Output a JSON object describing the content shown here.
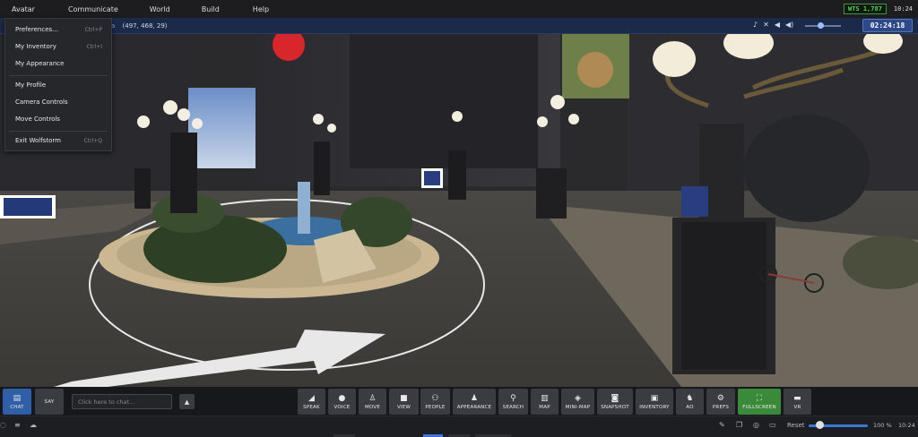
{
  "menu": {
    "items": [
      "Avatar",
      "Communicate",
      "World",
      "Build",
      "Help"
    ],
    "balance": "WTS 1,787",
    "time": "10:24"
  },
  "location": {
    "region_suffix": "a",
    "coords": "(497, 468, 29)"
  },
  "timer": "02:24:18",
  "dropdown": {
    "items": [
      {
        "label": "Preferences...",
        "shortcut": "Ctrl+P"
      },
      {
        "label": "My Inventory",
        "shortcut": "Ctrl+I"
      },
      {
        "label": "My Appearance",
        "shortcut": ""
      },
      {
        "label": "My Profile",
        "shortcut": ""
      },
      {
        "label": "Camera Controls",
        "shortcut": ""
      },
      {
        "label": "Move Controls",
        "shortcut": ""
      },
      {
        "label": "Exit Wolfstorm",
        "shortcut": "Ctrl+Q"
      }
    ]
  },
  "toolbar": {
    "chat_label": "CHAT",
    "say_label": "SAY",
    "chat_placeholder": "Click here to chat...",
    "buttons": [
      {
        "label": "SPEAK",
        "icon": "megaphone-icon"
      },
      {
        "label": "VOICE",
        "icon": "microphone-icon"
      },
      {
        "label": "MOVE",
        "icon": "walk-icon"
      },
      {
        "label": "VIEW",
        "icon": "camera-icon"
      },
      {
        "label": "PEOPLE",
        "icon": "people-icon"
      },
      {
        "label": "APPEARANCE",
        "icon": "person-icon"
      },
      {
        "label": "SEARCH",
        "icon": "search-icon"
      },
      {
        "label": "MAP",
        "icon": "map-icon"
      },
      {
        "label": "MINI-MAP",
        "icon": "compass-icon"
      },
      {
        "label": "SNAPSHOT",
        "icon": "snapshot-icon"
      },
      {
        "label": "INVENTORY",
        "icon": "inventory-icon"
      },
      {
        "label": "AO",
        "icon": "run-icon"
      },
      {
        "label": "PREFS",
        "icon": "gear-icon"
      },
      {
        "label": "FULLSCREEN",
        "icon": "fullscreen-icon"
      },
      {
        "label": "VR",
        "icon": "vr-icon"
      }
    ]
  },
  "status": {
    "reset_label": "Reset",
    "zoom": "100 %",
    "time": "10:24"
  },
  "colors": {
    "accent": "#2f5fa6",
    "fullscreen": "#3b8a3a",
    "balance": "#58d058"
  }
}
